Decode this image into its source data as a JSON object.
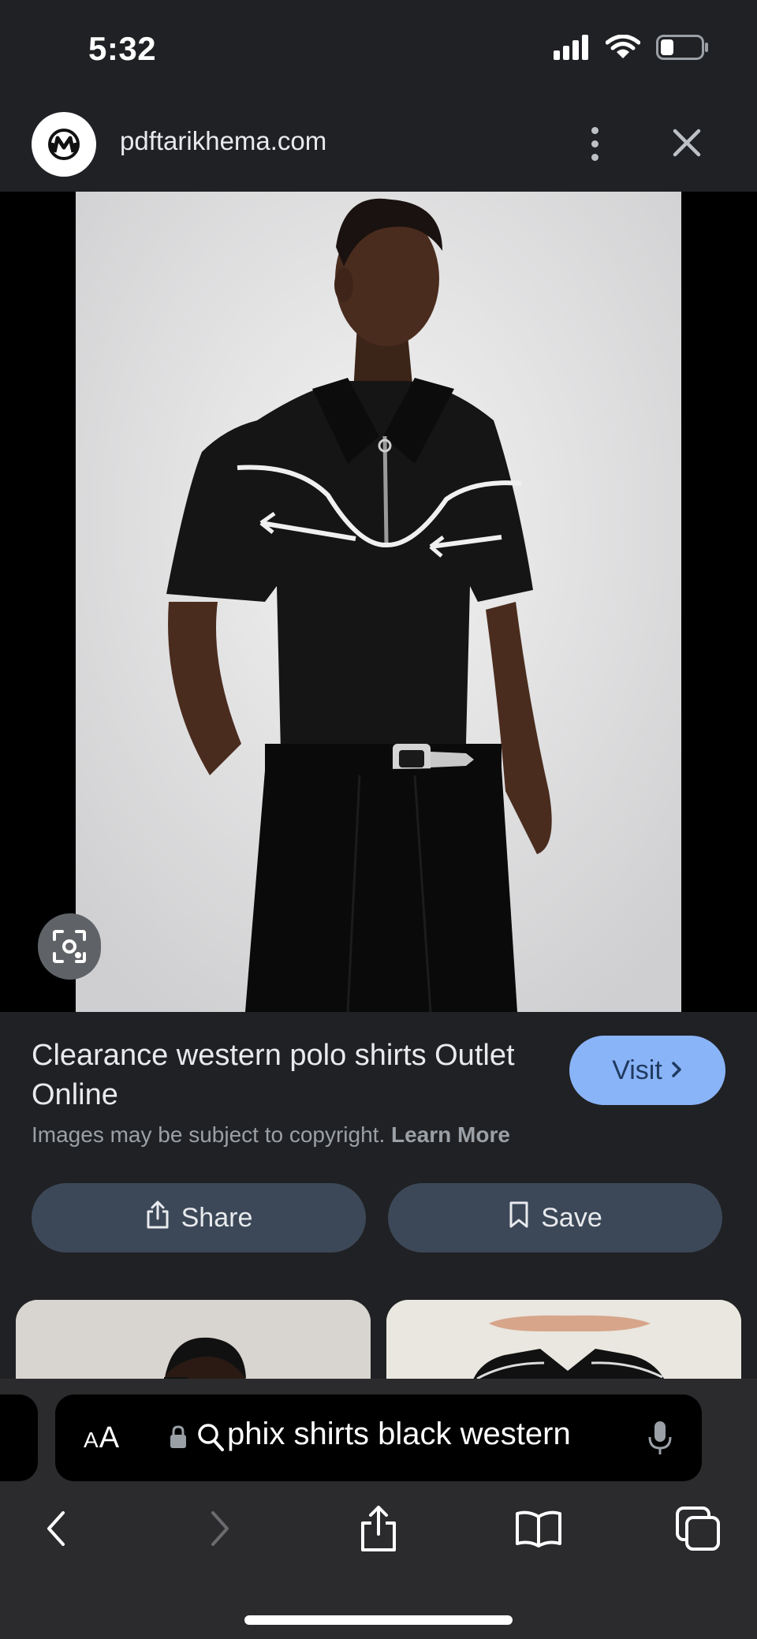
{
  "status_bar": {
    "time": "5:32"
  },
  "header": {
    "site": "pdftarikhema.com"
  },
  "result": {
    "title": "Clearance western polo shirts Outlet Online",
    "visit_label": "Visit",
    "copyright_text": "Images may be subject to copyright.",
    "learn_more": "Learn More"
  },
  "actions": {
    "share_label": "Share",
    "save_label": "Save"
  },
  "address_bar": {
    "aa_small": "A",
    "aa_large": "A",
    "url": "phix shirts black western"
  },
  "icons": {
    "status": [
      "signal-icon",
      "wifi-icon",
      "battery-icon"
    ],
    "header": [
      "site-logo-icon",
      "more-vert-icon",
      "close-icon"
    ],
    "image": [
      "lens-icon"
    ],
    "actions": [
      "share-icon",
      "bookmark-icon",
      "chevron-right-icon"
    ],
    "toolbar": [
      "back-icon",
      "forward-icon",
      "share-icon",
      "bookmarks-icon",
      "tabs-icon"
    ]
  },
  "colors": {
    "background": "#202124",
    "visit_button": "#8ab4f8",
    "action_button": "#3c4858",
    "toolbar": "#2b2b2d"
  }
}
